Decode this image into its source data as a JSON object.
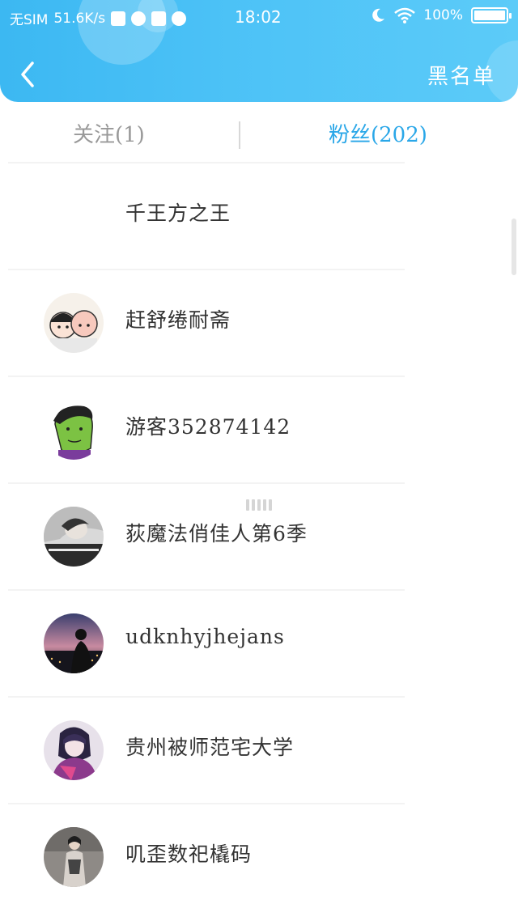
{
  "status_bar": {
    "carrier": "无SIM",
    "speed": "51.6K/s",
    "time": "18:02",
    "battery": "100%"
  },
  "header": {
    "right_action": "黑名单"
  },
  "tabs": {
    "follow": "关注(1)",
    "fans": "粉丝(202)"
  },
  "users": [
    {
      "name": "千王方之王",
      "avatar": "none"
    },
    {
      "name": "赶舒绻耐斋",
      "avatar": "cartoon-couple-avatar"
    },
    {
      "name": "游客352874142",
      "avatar": "hulk-cartoon-avatar"
    },
    {
      "name": "荻魔法俏佳人第6季",
      "avatar": "girl-photo-avatar"
    },
    {
      "name": "udknhyjhejans",
      "avatar": "sunset-silhouette-avatar"
    },
    {
      "name": "贵州被师范宅大学",
      "avatar": "anime-character-avatar"
    },
    {
      "name": "叽歪数祀橇码",
      "avatar": "person-photo-avatar"
    }
  ],
  "colors": {
    "header_start": "#3cb8f2",
    "header_end": "#5ccbf8",
    "tab_active": "#2aa7e8",
    "tab_inactive": "#999999"
  }
}
